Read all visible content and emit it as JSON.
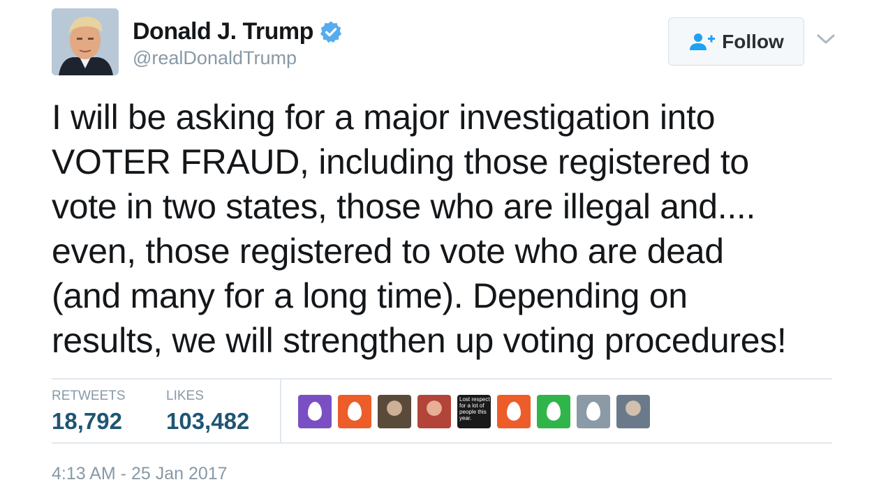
{
  "user": {
    "name": "Donald J. Trump",
    "handle": "@realDonaldTrump",
    "verified_color": "#55acee"
  },
  "follow": {
    "label": "Follow",
    "icon": "add-user-icon"
  },
  "menu": {
    "icon": "chevron-down-icon"
  },
  "tweet": {
    "lines": [
      "I will be asking for a major investigation into",
      "VOTER FRAUD, including those registered to",
      "vote in two states, those who are illegal and....",
      "even, those registered to vote who are dead",
      "(and many for a long time). Depending on",
      "results, we will strengthen up voting procedures!"
    ]
  },
  "stats": {
    "retweets_label": "RETWEETS",
    "retweets_value": "18,792",
    "likes_label": "LIKES",
    "likes_value": "103,482"
  },
  "likers": [
    {
      "type": "egg",
      "color": "#7b4fc4"
    },
    {
      "type": "egg",
      "color": "#ec5d2a"
    },
    {
      "type": "photo",
      "color": "#5a4a3a"
    },
    {
      "type": "photo",
      "color": "#b3443a"
    },
    {
      "type": "text",
      "color": "#1a1a1a",
      "text": "Lost respect for a lot of people this year."
    },
    {
      "type": "egg",
      "color": "#ec5d2a"
    },
    {
      "type": "egg",
      "color": "#2fb54a"
    },
    {
      "type": "egg",
      "color": "#8a9aa6"
    },
    {
      "type": "photo",
      "color": "#6a7a8a"
    }
  ],
  "timestamp": "4:13 AM - 25 Jan 2017",
  "colors": {
    "stat_value": "#1f5575",
    "muted": "#8899a6",
    "divider": "#e1e8ed"
  }
}
